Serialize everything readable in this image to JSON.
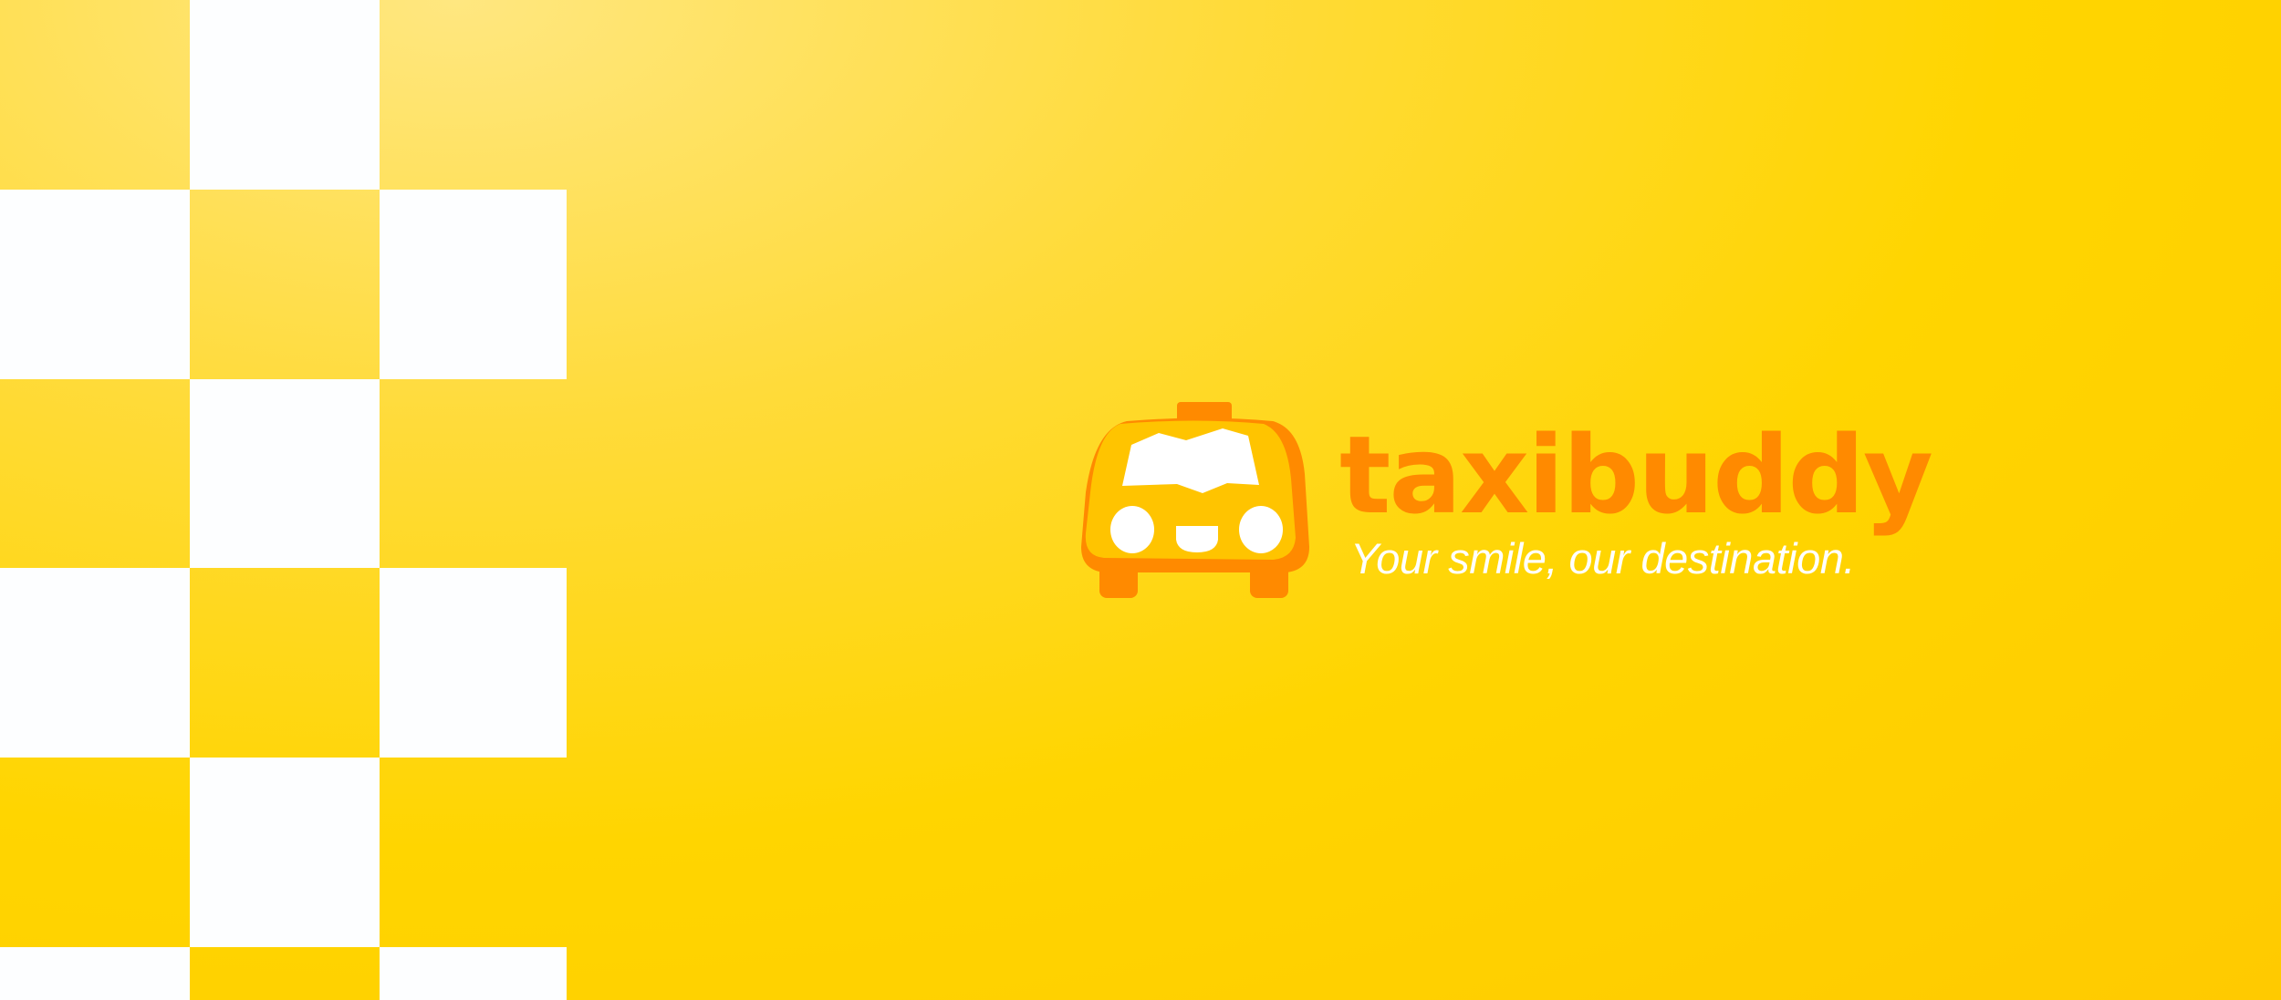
{
  "brand": {
    "name": "taxibuddy",
    "tagline": "Your smile, our destination.",
    "logo_icon": "taxi-car-smiling-icon"
  },
  "colors": {
    "background": "#FFD500",
    "logo_orange": "#FF8A00",
    "car_yellow": "#FFC400",
    "checker_white": "#FDFEFF"
  }
}
